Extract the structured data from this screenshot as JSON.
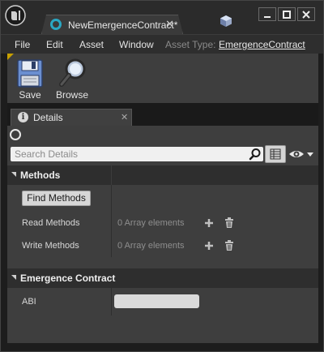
{
  "window": {
    "tab_title": "NewEmergenceContract*",
    "tab_close": "✕"
  },
  "menu": {
    "items": [
      "File",
      "Edit",
      "Asset",
      "Window"
    ],
    "asset_type_label": "Asset Type:",
    "asset_type_value": "EmergenceContract"
  },
  "toolbar": {
    "save_label": "Save",
    "browse_label": "Browse"
  },
  "details": {
    "tab_label": "Details",
    "tab_info_glyph": "i",
    "tab_close": "✕",
    "search_placeholder": "Search Details"
  },
  "categories": {
    "methods": {
      "title": "Methods",
      "find_button": "Find Methods",
      "read_label": "Read Methods",
      "read_value": "0 Array elements",
      "write_label": "Write Methods",
      "write_value": "0 Array elements"
    },
    "contract": {
      "title": "Emergence Contract",
      "abi_label": "ABI",
      "abi_value": ""
    }
  },
  "colors": {
    "accent_tab_icon": "#2aa8c4",
    "toolbar_grip": "#c8a000",
    "panel_bg": "#3e3e3e",
    "category_bg": "#2e2e2e"
  }
}
